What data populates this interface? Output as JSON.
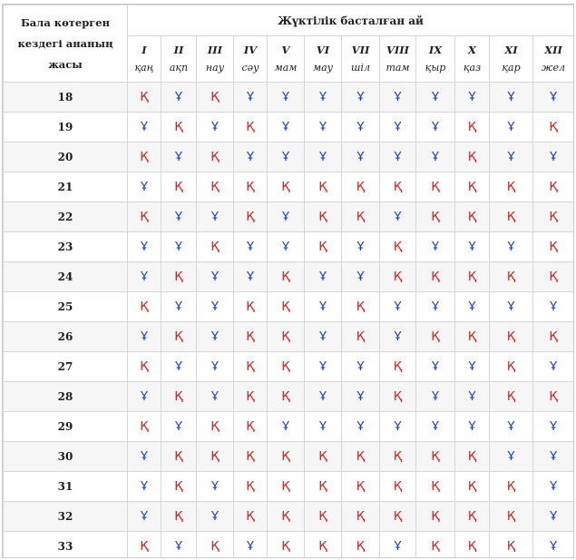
{
  "table": {
    "age_header": "Бала көтерген кездегі ананың жасы",
    "conception_header": "Жүктілік басталған ай",
    "months": [
      {
        "num": "I",
        "name": "қаң"
      },
      {
        "num": "II",
        "name": "ақп"
      },
      {
        "num": "III",
        "name": "нау"
      },
      {
        "num": "IV",
        "name": "сәу"
      },
      {
        "num": "V",
        "name": "мам"
      },
      {
        "num": "VI",
        "name": "мау"
      },
      {
        "num": "VII",
        "name": "шіл"
      },
      {
        "num": "VIII",
        "name": "там"
      },
      {
        "num": "IX",
        "name": "қыр"
      },
      {
        "num": "X",
        "name": "қаз"
      },
      {
        "num": "XI",
        "name": "қар"
      },
      {
        "num": "XII",
        "name": "жел"
      }
    ],
    "rows": [
      {
        "age": "18",
        "cells": [
          "Қ",
          "Ұ",
          "Қ",
          "Ұ",
          "Ұ",
          "Ұ",
          "Ұ",
          "Ұ",
          "Ұ",
          "Ұ",
          "Ұ",
          "Ұ"
        ]
      },
      {
        "age": "19",
        "cells": [
          "Ұ",
          "Қ",
          "Ұ",
          "Қ",
          "Ұ",
          "Ұ",
          "Ұ",
          "Ұ",
          "Ұ",
          "Қ",
          "Ұ",
          "Қ"
        ]
      },
      {
        "age": "20",
        "cells": [
          "Қ",
          "Ұ",
          "Қ",
          "Ұ",
          "Ұ",
          "Ұ",
          "Ұ",
          "Ұ",
          "Ұ",
          "Қ",
          "Ұ",
          "Ұ"
        ]
      },
      {
        "age": "21",
        "cells": [
          "Ұ",
          "Қ",
          "Қ",
          "Қ",
          "Қ",
          "Қ",
          "Қ",
          "Қ",
          "Қ",
          "Қ",
          "Қ",
          "Қ"
        ]
      },
      {
        "age": "22",
        "cells": [
          "Қ",
          "Ұ",
          "Ұ",
          "Қ",
          "Ұ",
          "Қ",
          "Қ",
          "Ұ",
          "Қ",
          "Қ",
          "Қ",
          "Қ"
        ]
      },
      {
        "age": "23",
        "cells": [
          "Ұ",
          "Ұ",
          "Қ",
          "Ұ",
          "Ұ",
          "Қ",
          "Ұ",
          "Қ",
          "Ұ",
          "Ұ",
          "Ұ",
          "Қ"
        ]
      },
      {
        "age": "24",
        "cells": [
          "Ұ",
          "Қ",
          "Ұ",
          "Ұ",
          "Қ",
          "Ұ",
          "Ұ",
          "Қ",
          "Қ",
          "Қ",
          "Қ",
          "Қ"
        ]
      },
      {
        "age": "25",
        "cells": [
          "Қ",
          "Ұ",
          "Ұ",
          "Қ",
          "Қ",
          "Ұ",
          "Қ",
          "Ұ",
          "Ұ",
          "Ұ",
          "Ұ",
          "Ұ"
        ]
      },
      {
        "age": "26",
        "cells": [
          "Ұ",
          "Қ",
          "Ұ",
          "Қ",
          "Қ",
          "Ұ",
          "Қ",
          "Ұ",
          "Қ",
          "Қ",
          "Қ",
          "Қ"
        ]
      },
      {
        "age": "27",
        "cells": [
          "Қ",
          "Ұ",
          "Ұ",
          "Қ",
          "Қ",
          "Ұ",
          "Ұ",
          "Қ",
          "Ұ",
          "Ұ",
          "Қ",
          "Ұ"
        ]
      },
      {
        "age": "28",
        "cells": [
          "Ұ",
          "Қ",
          "Ұ",
          "Қ",
          "Қ",
          "Ұ",
          "Ұ",
          "Қ",
          "Ұ",
          "Ұ",
          "Қ",
          "Қ"
        ]
      },
      {
        "age": "29",
        "cells": [
          "Қ",
          "Ұ",
          "Қ",
          "Қ",
          "Ұ",
          "Ұ",
          "Ұ",
          "Ұ",
          "Ұ",
          "Ұ",
          "Ұ",
          "Ұ"
        ]
      },
      {
        "age": "30",
        "cells": [
          "Ұ",
          "Қ",
          "Қ",
          "Қ",
          "Қ",
          "Қ",
          "Қ",
          "Қ",
          "Қ",
          "Қ",
          "Ұ",
          "Ұ"
        ]
      },
      {
        "age": "31",
        "cells": [
          "Ұ",
          "Қ",
          "Ұ",
          "Қ",
          "Қ",
          "Қ",
          "Қ",
          "Қ",
          "Қ",
          "Қ",
          "Қ",
          "Ұ"
        ]
      },
      {
        "age": "32",
        "cells": [
          "Ұ",
          "Қ",
          "Ұ",
          "Қ",
          "Қ",
          "Қ",
          "Қ",
          "Қ",
          "Қ",
          "Қ",
          "Қ",
          "Ұ"
        ]
      },
      {
        "age": "33",
        "cells": [
          "Қ",
          "Ұ",
          "Қ",
          "Ұ",
          "Қ",
          "Қ",
          "Қ",
          "Ұ",
          "Қ",
          "Қ",
          "Қ",
          "Ұ"
        ]
      }
    ]
  },
  "colors": {
    "girl_letter": "#d21f1f",
    "boy_letter": "#1a3ec8"
  }
}
